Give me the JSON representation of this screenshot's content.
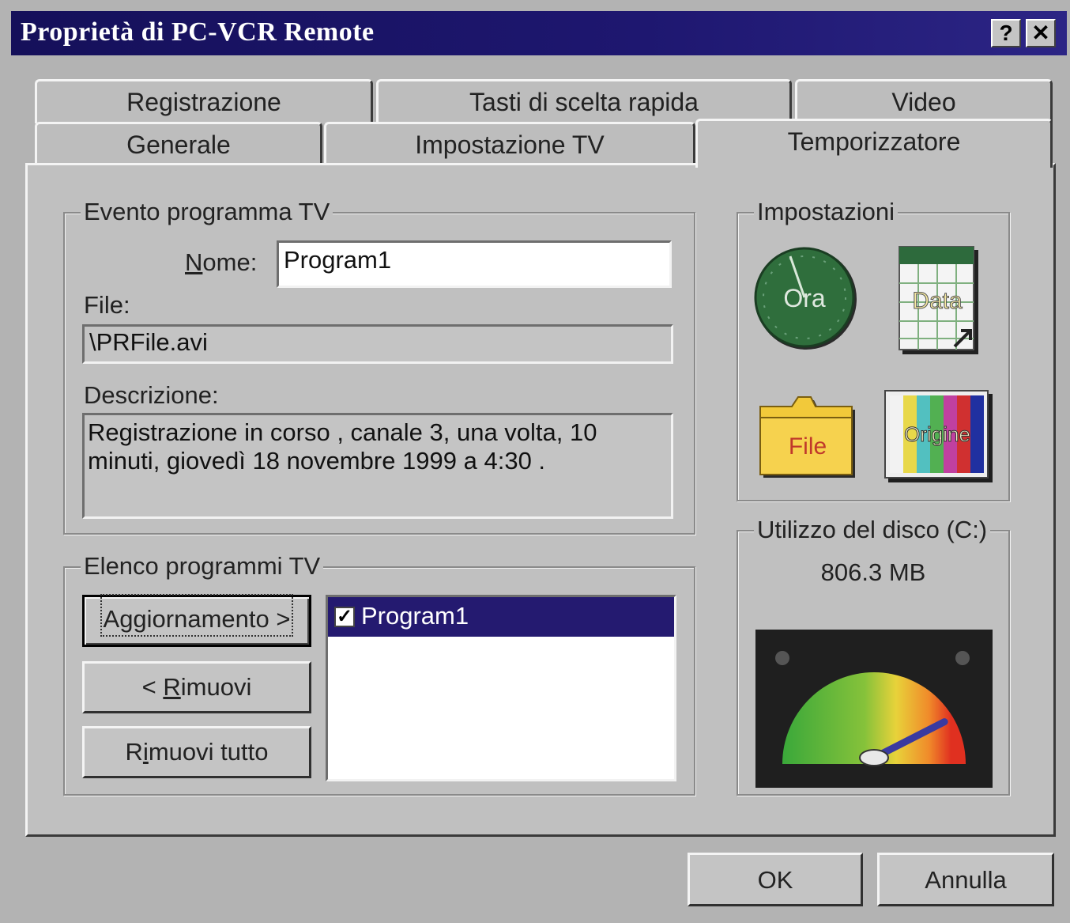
{
  "window": {
    "title": "Proprietà di PC-VCR Remote",
    "help_glyph": "?",
    "close_glyph": "✕"
  },
  "tabs": {
    "row_back": [
      "Registrazione",
      "Tasti di scelta rapida",
      "Video"
    ],
    "row_front": [
      "Generale",
      "Impostazione TV",
      "Temporizzatore"
    ],
    "active": "Temporizzatore"
  },
  "event_group": {
    "legend": "Evento programma TV",
    "name_label": "Nome:",
    "name_value": "Program1",
    "file_label": "File:",
    "file_value": "\\PRFile.avi",
    "description_label": "Descrizione:",
    "description_line1": "Registrazione in corso , canale 3, una volta, 10",
    "description_line2": "minuti, giovedì 18 novembre 1999 a 4:30 ."
  },
  "list_group": {
    "legend": "Elenco programmi TV",
    "update_button": "Aggiornamento >",
    "remove_button": "< Rimuovi",
    "remove_all_button": "Rimuovi tutto",
    "items": [
      {
        "label": "Program1",
        "checked": true,
        "selected": true
      }
    ]
  },
  "settings_group": {
    "legend": "Impostazioni",
    "icons": [
      {
        "name": "clock-icon",
        "label": "Ora"
      },
      {
        "name": "calendar-icon",
        "label": "Data"
      },
      {
        "name": "folder-icon",
        "label": "File"
      },
      {
        "name": "signal-icon",
        "label": "Origine"
      }
    ]
  },
  "disk_group": {
    "legend": "Utilizzo del disco (C:)",
    "free_space": "806.3 MB",
    "gauge_level": 0.85
  },
  "footer": {
    "ok_button": "OK",
    "cancel_button": "Annulla"
  },
  "colors": {
    "titlebar": "#1e1770",
    "face": "#c0c0c0",
    "selection": "#241a70",
    "clock": "#2e6b3a",
    "folder": "#f0c83c"
  }
}
